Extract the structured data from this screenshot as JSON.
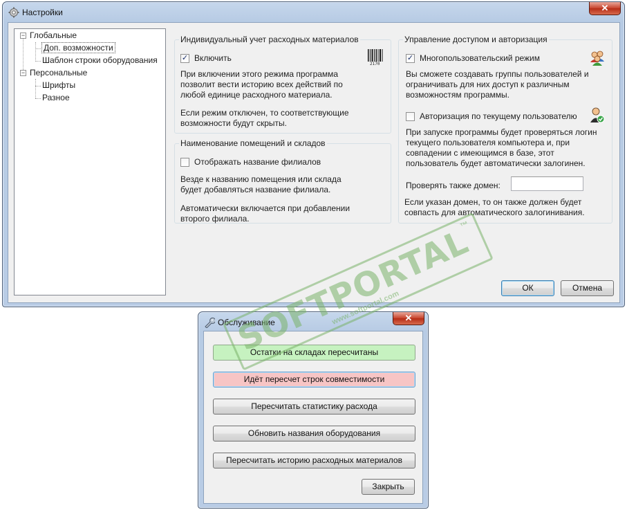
{
  "settings_window": {
    "title": "Настройки",
    "close_glyph": "✕",
    "tree": [
      {
        "label": "Глобальные",
        "expander": "−"
      },
      {
        "label": "Доп. возможности"
      },
      {
        "label": "Шаблон строки оборудования"
      },
      {
        "label": "Персональные",
        "expander": "−"
      },
      {
        "label": "Шрифты"
      },
      {
        "label": "Разное"
      }
    ],
    "consumables": {
      "title": "Индивидуальный учет расходных материалов",
      "checkbox_label": "Включить",
      "checked": true,
      "barcode_text": "2170",
      "desc1": "При включении этого режима программа позволит вести историю всех действий по любой единице расходного материала.",
      "desc2": "Если режим отключен, то соответствующие возможности будут скрыты."
    },
    "rooms": {
      "title": "Наименование помещений и складов",
      "checkbox_label": "Отображать название филиалов",
      "checked": false,
      "desc1": "Везде к названию помещения или склада будет добавляться название филиала.",
      "desc2": "Автоматически включается при добавлении второго филиала."
    },
    "access": {
      "title": "Управление доступом и авторизация",
      "multiuser_label": "Многопользовательский режим",
      "multiuser_checked": true,
      "desc1": "Вы сможете создавать группы пользователей и ограничивать для них доступ к различным возможностям программы.",
      "auth_label": "Авторизация по текущему пользователю",
      "auth_checked": false,
      "desc2": "При запуске программы будет проверяться логин текущего пользователя компьютера и, при совпадении с имеющимся в базе, этот пользователь будет автоматически залогинен.",
      "domain_label": "Проверять также домен:",
      "domain_value": "",
      "desc3": "Если указан домен, то он также должен будет совпасть для автоматического залогинивания."
    },
    "ok_label": "ОК",
    "cancel_label": "Отмена"
  },
  "maintenance_window": {
    "title": "Обслуживание",
    "close_glyph": "✕",
    "buttons": [
      {
        "label": "Остатки на складах пересчитаны",
        "state": "done",
        "color": "#c6f2c0"
      },
      {
        "label": "Идёт пересчет строк совместимости",
        "state": "in-progress",
        "color": "#f7c5c5"
      },
      {
        "label": "Пересчитать статистику расхода",
        "state": "idle"
      },
      {
        "label": "Обновить названия оборудования",
        "state": "idle"
      },
      {
        "label": "Пересчитать историю расходных материалов",
        "state": "idle"
      }
    ],
    "close_label": "Закрыть"
  },
  "watermark": {
    "brand": "SOFTPORTAL",
    "tm": "™",
    "url": "www.softportal.com"
  },
  "colors": {
    "done_button": "#c6f2c0",
    "progress_button": "#f7c5c5",
    "title_gradient": "#b9cce5",
    "close_button": "#c7422b"
  }
}
